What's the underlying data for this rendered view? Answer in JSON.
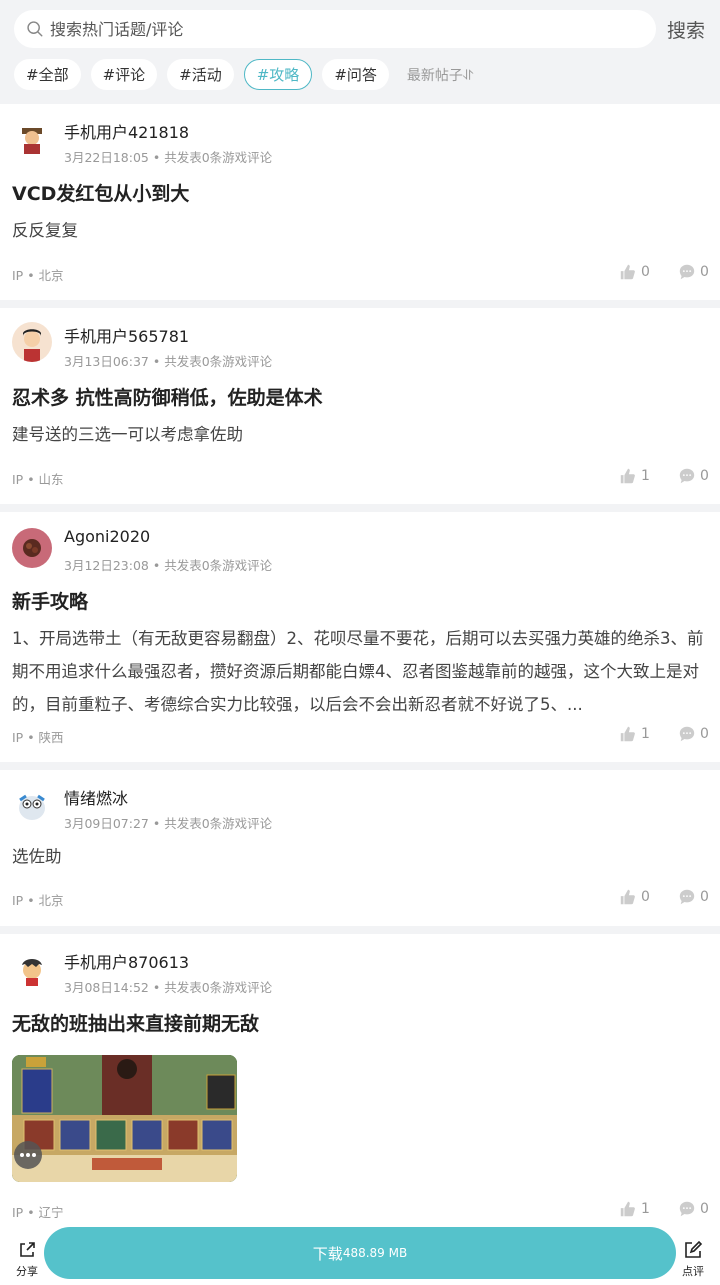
{
  "search": {
    "placeholder": "搜索热门话题/评论",
    "button": "搜索"
  },
  "tags": [
    "#全部",
    "#评论",
    "#活动",
    "#攻略",
    "#问答"
  ],
  "active_tag": "#攻略",
  "sort_label": "最新帖子⥯",
  "posts": [
    {
      "user": "手机用户421818",
      "meta": "3月22日18:05 • 共发表0条游戏评论",
      "title": "VCD发红包从小到大",
      "body": "反反复复",
      "ip": "IP • 北京",
      "likes": "0",
      "comments": "0"
    },
    {
      "user": "手机用户565781",
      "meta": "3月13日06:37 • 共发表0条游戏评论",
      "title": "忍术多 抗性高防御稍低，佐助是体术",
      "body": "建号送的三选一可以考虑拿佐助",
      "ip": "IP • 山东",
      "likes": "1",
      "comments": "0"
    },
    {
      "user": "Agoni2020",
      "meta": "3月12日23:08 • 共发表0条游戏评论",
      "title": "新手攻略",
      "body": "1、开局选带土（有无敌更容易翻盘）2、花呗尽量不要花，后期可以去买强力英雄的绝杀3、前期不用追求什么最强忍者，攒好资源后期都能白嫖4、忍者图鉴越靠前的越强，这个大致上是对的，目前重粒子、考德综合实力比较强，以后会不会出新忍者就不好说了5、...",
      "ip": "IP • 陕西",
      "likes": "1",
      "comments": "0"
    },
    {
      "user": "情绪燃冰",
      "meta": "3月09日07:27 • 共发表0条游戏评论",
      "title": "",
      "body": "选佐助",
      "ip": "IP • 北京",
      "likes": "0",
      "comments": "0"
    },
    {
      "user": "手机用户870613",
      "meta": "3月08日14:52 • 共发表0条游戏评论",
      "title": "无敌的班抽出来直接前期无敌",
      "body": "",
      "ip": "IP • 辽宁",
      "likes": "1",
      "comments": "0"
    }
  ],
  "bottom": {
    "share": "分享",
    "download": "下载",
    "size": "488.89 MB",
    "review": "点评"
  }
}
